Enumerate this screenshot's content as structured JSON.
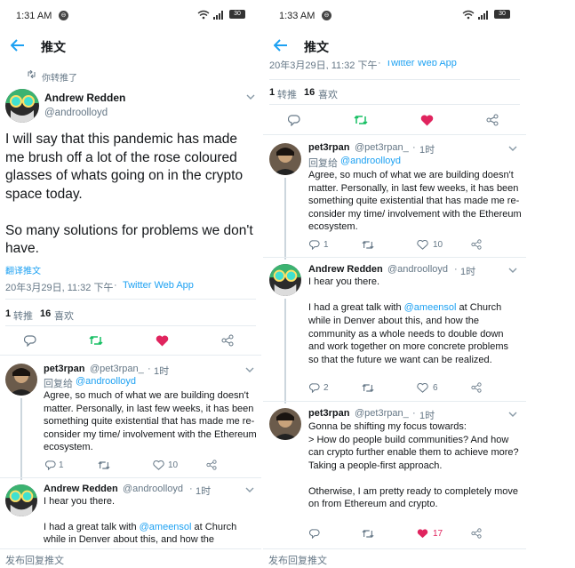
{
  "screens": [
    {
      "status": {
        "time": "1:31 AM",
        "notification_badge": "⊖",
        "battery": "30"
      },
      "header": {
        "title": "推文"
      },
      "retweet_context": "你转推了",
      "main_tweet": {
        "name": "Andrew Redden",
        "handle": "@androolloyd",
        "text": "I will say that this pandemic has made me brush off a lot of the rose coloured glasses of whats going on in the crypto space today.\n\nSo many solutions for problems we don't have.",
        "translate": "翻译推文",
        "timestamp": "20年3月29日, 11:32 下午",
        "source": "Twitter Web App",
        "retweets_count": "1",
        "retweets_label": "转推",
        "likes_count": "16",
        "likes_label": "喜欢"
      },
      "replies": [
        {
          "name": "pet3rpan",
          "handle": "@pet3rpan_",
          "time": "1时",
          "reply_to_label": "回复给",
          "reply_to": "@androolloyd",
          "text": "Agree, so much of what we are building doesn't matter. Personally, in last few weeks, it has been something quite existential that has made me re-consider my time/ involvement with the Ethereum ecosystem.",
          "reply_count": "1",
          "retweet_count": "",
          "like_count": "10"
        },
        {
          "name": "Andrew Redden",
          "handle": "@androolloyd",
          "time": "1时",
          "text_1": "I hear you there.",
          "text_2a": "I had a great talk with ",
          "mention": "@ameensol",
          "text_2b": " at Church",
          "text_3": "while in Denver about this, and how the"
        }
      ],
      "compose": "发布回复推文"
    },
    {
      "status": {
        "time": "1:33 AM",
        "notification_badge": "⊖",
        "battery": "30"
      },
      "header": {
        "title": "推文"
      },
      "cut_timestamp": "20年3月29日, 11:32 下午",
      "cut_source": "Twitter Web App",
      "stats": {
        "retweets_count": "1",
        "retweets_label": "转推",
        "likes_count": "16",
        "likes_label": "喜欢"
      },
      "replies": [
        {
          "name": "pet3rpan",
          "handle": "@pet3rpan_",
          "time": "1时",
          "reply_to_label": "回复给",
          "reply_to": "@androolloyd",
          "text": "Agree, so much of what we are building doesn't matter. Personally, in last few weeks, it has been something quite existential that has made me re-consider my time/ involvement with the Ethereum ecosystem.",
          "reply_count": "1",
          "retweet_count": "",
          "like_count": "10"
        },
        {
          "name": "Andrew Redden",
          "handle": "@androolloyd",
          "time": "1时",
          "text_1": "I hear you there.",
          "text_2a": "I had a great talk with ",
          "mention": "@ameensol",
          "text_2b": " at Church",
          "text_rest": "while in Denver about this, and how the community as a whole needs to double down and work together on more concrete problems so that the future we want can be realized.",
          "reply_count": "2",
          "retweet_count": "",
          "like_count": "6"
        },
        {
          "name": "pet3rpan",
          "handle": "@pet3rpan_",
          "time": "1时",
          "text": "Gonna be shifting my focus towards:\n> How do people build communities? And how can crypto further enable them to achieve more? Taking a people-first approach.\n\nOtherwise, I am pretty ready to completely move on from Ethereum and crypto.",
          "reply_count": "",
          "retweet_count": "",
          "like_count": "17"
        }
      ],
      "compose": "发布回复推文"
    }
  ],
  "colors": {
    "accent": "#1da1f2",
    "retweet_green": "#17bf63",
    "like_red": "#e0245e",
    "muted": "#657786"
  },
  "icons": [
    "back-arrow-icon",
    "chevron-down-icon",
    "reply-icon",
    "retweet-icon",
    "like-icon",
    "share-icon",
    "wifi-icon",
    "signal-icon",
    "battery-icon"
  ]
}
